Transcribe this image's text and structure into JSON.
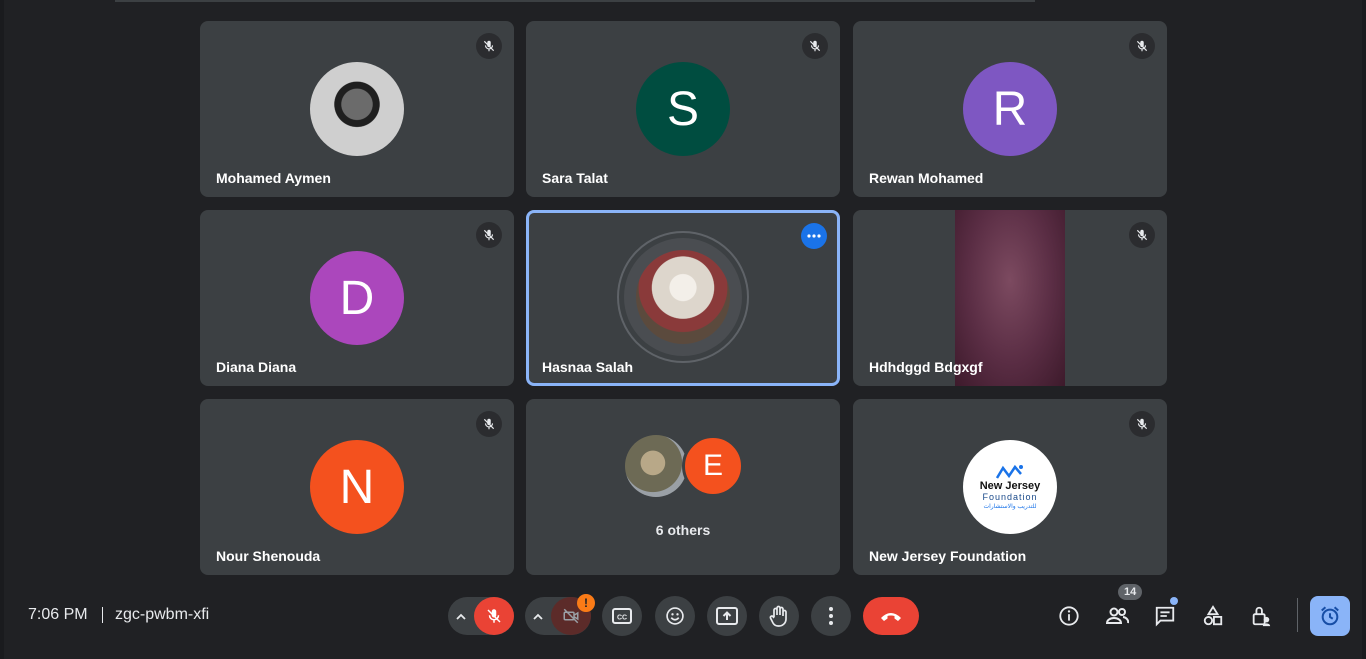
{
  "participants": [
    {
      "name": "Mohamed Aymen",
      "avatar": "photo",
      "muted": true
    },
    {
      "name": "Sara Talat",
      "initial": "S",
      "color": "#004d40",
      "muted": true
    },
    {
      "name": "Rewan Mohamed",
      "initial": "R",
      "color": "#7e57c2",
      "muted": true
    },
    {
      "name": "Diana Diana",
      "initial": "D",
      "color": "#ab47bc",
      "muted": true
    },
    {
      "name": "Hasnaa Salah",
      "avatar": "photo",
      "muted": false,
      "speaking": true
    },
    {
      "name": "Hdhdggd Bdgxgf",
      "avatar": "video",
      "muted": true
    },
    {
      "name": "Nour Shenouda",
      "initial": "N",
      "color": "#f4511e",
      "muted": true
    },
    {
      "name": "New Jersey Foundation",
      "avatar": "logo",
      "muted": true
    }
  ],
  "others": {
    "label": "6 others",
    "initial": "E",
    "color": "#f4511e"
  },
  "logo": {
    "line1": "New Jersey",
    "line2": "Foundation",
    "line3": "للتدريب والاستشارات"
  },
  "bottom_bar": {
    "time": "7:06 PM",
    "meeting_code": "zgc-pwbm-xfi",
    "people_count": "14",
    "camera_warning": "!"
  },
  "colors": {
    "background": "#202124",
    "tile": "#3c4043",
    "danger": "#ea4335",
    "accent": "#8ab4f8",
    "primary": "#1a73e8"
  }
}
